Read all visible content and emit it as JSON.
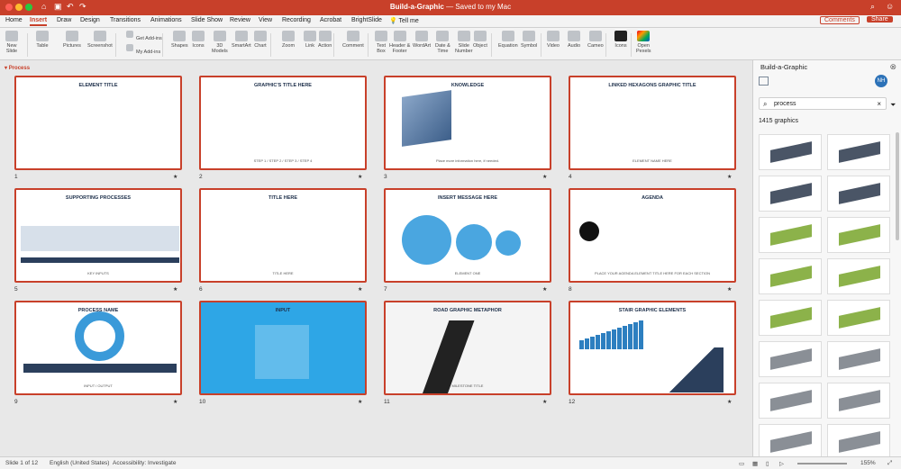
{
  "app": {
    "title": "Build-a-Graphic",
    "saved": "Saved to my Mac",
    "tell_me": "Tell me"
  },
  "tabs": [
    "Home",
    "Insert",
    "Draw",
    "Design",
    "Transitions",
    "Animations",
    "Slide Show",
    "Review",
    "View",
    "Recording",
    "Acrobat",
    "BrightSlide"
  ],
  "header_buttons": {
    "comments": "Comments",
    "share": "Share"
  },
  "ribbon": [
    {
      "label": "New\nSlide",
      "icon": "new-slide-icon"
    },
    {
      "label": "Table",
      "icon": "table-icon"
    },
    {
      "label": "Pictures",
      "icon": "pictures-icon"
    },
    {
      "label": "Screenshot",
      "icon": "screenshot-icon"
    },
    {
      "label": "Get Add-ins",
      "icon": "addins-icon"
    },
    {
      "label": "My Add-ins",
      "icon": "my-addins-icon"
    },
    {
      "label": "Shapes",
      "icon": "shapes-icon"
    },
    {
      "label": "Icons",
      "icon": "icons-icon"
    },
    {
      "label": "3D\nModels",
      "icon": "3d-icon"
    },
    {
      "label": "SmartArt",
      "icon": "smartart-icon"
    },
    {
      "label": "Chart",
      "icon": "chart-icon"
    },
    {
      "label": "Zoom",
      "icon": "zoom-icon"
    },
    {
      "label": "Link",
      "icon": "link-icon"
    },
    {
      "label": "Action",
      "icon": "action-icon"
    },
    {
      "label": "Comment",
      "icon": "comment-icon"
    },
    {
      "label": "Text\nBox",
      "icon": "textbox-icon"
    },
    {
      "label": "Header &\nFooter",
      "icon": "header-footer-icon"
    },
    {
      "label": "WordArt",
      "icon": "wordart-icon"
    },
    {
      "label": "Date &\nTime",
      "icon": "datetime-icon"
    },
    {
      "label": "Slide\nNumber",
      "icon": "slide-number-icon"
    },
    {
      "label": "Object",
      "icon": "object-icon"
    },
    {
      "label": "Equation",
      "icon": "equation-icon"
    },
    {
      "label": "Symbol",
      "icon": "symbol-icon"
    },
    {
      "label": "Video",
      "icon": "video-icon"
    },
    {
      "label": "Audio",
      "icon": "audio-icon"
    },
    {
      "label": "Cameo",
      "icon": "cameo-icon"
    },
    {
      "label": "Icons",
      "icon": "icons-addin-icon"
    },
    {
      "label": "Open\nPexels",
      "icon": "pexels-icon"
    }
  ],
  "section": "Process",
  "slides": [
    {
      "num": "1",
      "t1": "ELEMENT TITLE",
      "t2": ""
    },
    {
      "num": "2",
      "t1": "GRAPHIC'S TITLE HERE",
      "t2": "STEP 1 / STEP 2 / STEP 3 / STEP 4"
    },
    {
      "num": "3",
      "t1": "KNOWLEDGE",
      "t2": "Place more information here, if needed."
    },
    {
      "num": "4",
      "t1": "LINKED HEXAGONS GRAPHIC TITLE",
      "t2": "ELEMENT NAME HERE"
    },
    {
      "num": "5",
      "t1": "SUPPORTING PROCESSES",
      "t2": "KEY INPUTS"
    },
    {
      "num": "6",
      "t1": "TITLE HERE",
      "t2": "TITLE HERE"
    },
    {
      "num": "7",
      "t1": "INSERT MESSAGE HERE",
      "t2": "ELEMENT ONE"
    },
    {
      "num": "8",
      "t1": "AGENDA",
      "t2": "PLACE YOUR AGENDA ELEMENT TITLE HERE FOR EACH SECTION"
    },
    {
      "num": "9",
      "t1": "PROCESS NAME",
      "t2": "INPUT / OUTPUT"
    },
    {
      "num": "10",
      "t1": "INPUT",
      "t2": ""
    },
    {
      "num": "11",
      "t1": "ROAD GRAPHIC METAPHOR",
      "t2": "MILESTONE TITLE"
    },
    {
      "num": "12",
      "t1": "STAIR GRAPHIC ELEMENTS",
      "t2": ""
    }
  ],
  "panel": {
    "title": "Build-a-Graphic",
    "avatar": "NH",
    "search_value": "process",
    "count": "1415 graphics"
  },
  "status": {
    "slide": "Slide 1 of 12",
    "language": "English (United States)",
    "accessibility": "Accessibility: Investigate",
    "zoom": "155%"
  }
}
